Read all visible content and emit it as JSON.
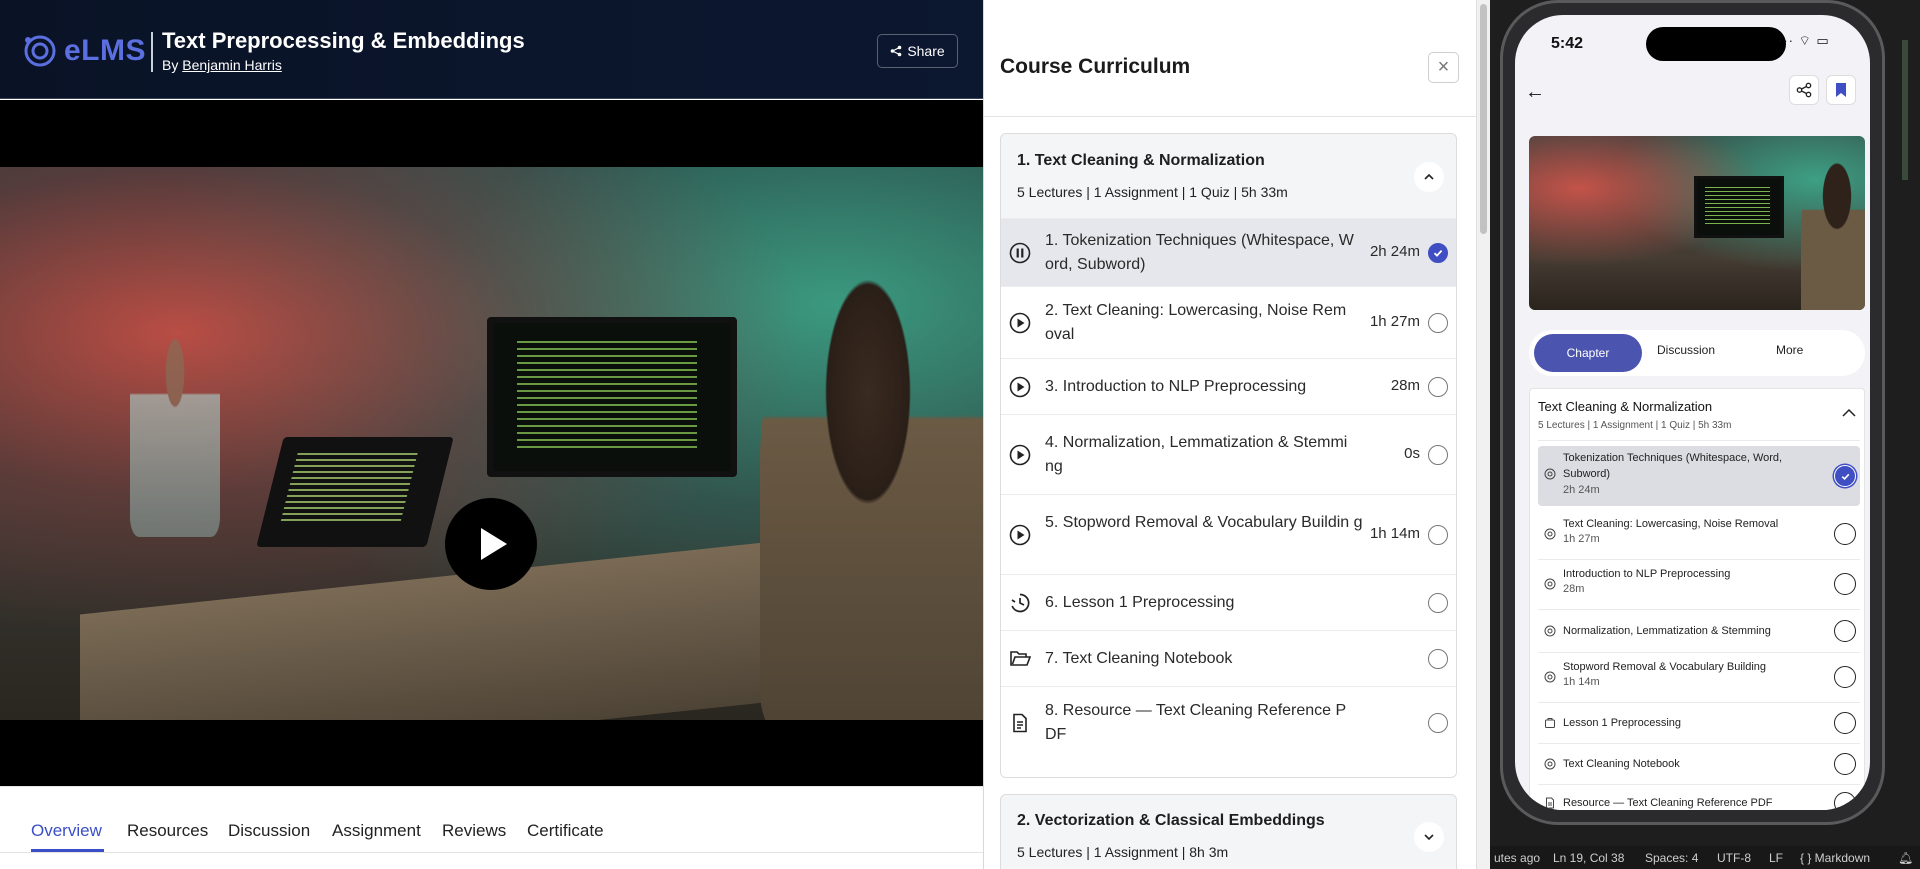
{
  "brand": {
    "name": "eLMS",
    "accent": "#3f4fc3"
  },
  "course": {
    "title": "Text Preprocessing & Embeddings",
    "by_prefix": "By",
    "author": "Benjamin Harris",
    "share_label": "Share"
  },
  "player": {
    "play_icon": "play-icon"
  },
  "tabs": [
    "Overview",
    "Resources",
    "Discussion",
    "Assignment",
    "Reviews",
    "Certificate"
  ],
  "curriculum": {
    "title": "Course Curriculum",
    "close_label": "×",
    "section1": {
      "title": "1. Text Cleaning & Normalization",
      "meta": "5 Lectures | 1 Assignment | 1 Quiz | 5h 33m",
      "lessons": [
        {
          "title": "1. Tokenization Techniques (Whitespace, W ord, Subword)",
          "duration": "2h 24m",
          "icon": "pause-circle-icon",
          "done": true
        },
        {
          "title": "2. Text Cleaning: Lowercasing, Noise Rem oval",
          "duration": "1h 27m",
          "icon": "play-circle-icon",
          "done": false
        },
        {
          "title": "3. Introduction to NLP Preprocessing",
          "duration": "28m",
          "icon": "play-circle-icon",
          "done": false
        },
        {
          "title": "4. Normalization, Lemmatization & Stemmi ng",
          "duration": "0s",
          "icon": "play-circle-icon",
          "done": false
        },
        {
          "title": "5. Stopword Removal & Vocabulary Buildin g",
          "duration": "1h 14m",
          "icon": "play-circle-icon",
          "done": false
        },
        {
          "title": "6. Lesson 1 Preprocessing",
          "duration": "",
          "icon": "quiz-timer-icon",
          "done": false
        },
        {
          "title": "7. Text Cleaning Notebook",
          "duration": "",
          "icon": "folder-icon",
          "done": false
        },
        {
          "title": "8. Resource — Text Cleaning Reference P DF",
          "duration": "",
          "icon": "document-icon",
          "done": false
        }
      ]
    },
    "section2": {
      "title": "2. Vectorization & Classical Embeddings",
      "meta": "5 Lectures | 1 Assignment | 8h 3m"
    }
  },
  "phone": {
    "time": "5:42",
    "status_icons": "···  ⌔  ▭",
    "tabs": {
      "chapter": "Chapter",
      "discussion": "Discussion",
      "more": "More"
    },
    "section": {
      "title": "Text Cleaning & Normalization",
      "meta": "5 Lectures | 1 Assignment | 1 Quiz | 5h 33m"
    },
    "lessons": [
      {
        "title": "Tokenization Techniques (Whitespace, Word, Subword)",
        "duration": "2h 24m",
        "done": true
      },
      {
        "title": "Text Cleaning: Lowercasing, Noise Removal",
        "duration": "1h 27m",
        "done": false
      },
      {
        "title": "Introduction to NLP Preprocessing",
        "duration": "28m",
        "done": false
      },
      {
        "title": "Normalization, Lemmatization & Stemming",
        "duration": "",
        "done": false
      },
      {
        "title": "Stopword Removal & Vocabulary Building",
        "duration": "1h 14m",
        "done": false
      },
      {
        "title": "Lesson 1 Preprocessing",
        "duration": "",
        "done": false
      },
      {
        "title": "Text Cleaning Notebook",
        "duration": "",
        "done": false
      },
      {
        "title": "Resource — Text Cleaning Reference PDF",
        "duration": "",
        "done": false
      }
    ]
  },
  "editor_status": {
    "left": "utes ago",
    "position": "Ln 19, Col 38",
    "spaces": "Spaces: 4",
    "encoding": "UTF-8",
    "eol": "LF",
    "language": "{ } Markdown"
  }
}
